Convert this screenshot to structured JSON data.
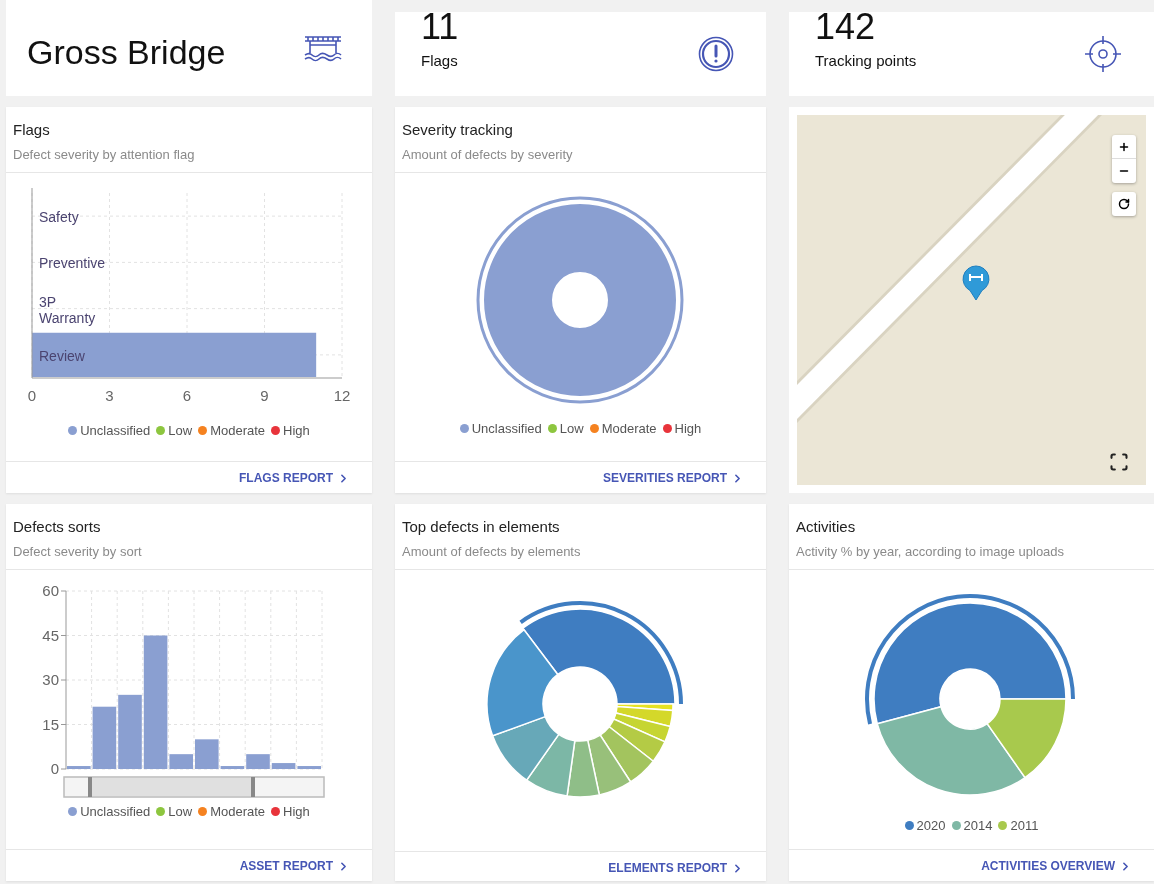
{
  "header_cards": [
    {
      "kind": "title",
      "title": "Gross Bridge"
    },
    {
      "kind": "stat",
      "value": "11",
      "label": "Flags"
    },
    {
      "kind": "stat",
      "value": "142",
      "label": "Tracking points"
    }
  ],
  "flags": {
    "title": "Flags",
    "subtitle": "Defect severity by attention flag",
    "chart_data": {
      "type": "bar",
      "orientation": "horizontal",
      "grid": true,
      "categories": [
        "Safety",
        "Preventive",
        "3P Warranty",
        "Review"
      ],
      "series": [
        {
          "name": "Unclassified",
          "color": "#8a9fd1",
          "values": [
            0,
            0,
            0,
            11
          ]
        },
        {
          "name": "Low",
          "color": "#8dc63f",
          "values": [
            0,
            0,
            0,
            0
          ]
        },
        {
          "name": "Moderate",
          "color": "#f58220",
          "values": [
            0,
            0,
            0,
            0
          ]
        },
        {
          "name": "High",
          "color": "#e8343b",
          "values": [
            0,
            0,
            0,
            0
          ]
        }
      ],
      "xlim": [
        0,
        12
      ],
      "xticks": [
        0,
        3,
        6,
        9,
        12
      ]
    },
    "link": "FLAGS REPORT"
  },
  "severity": {
    "title": "Severity tracking",
    "subtitle": "Amount of defects by severity",
    "legend": [
      {
        "label": "Unclassified",
        "color": "#8a9fd1"
      },
      {
        "label": "Low",
        "color": "#8dc63f"
      },
      {
        "label": "Moderate",
        "color": "#f58220"
      },
      {
        "label": "High",
        "color": "#e8343b"
      }
    ],
    "link": "SEVERITIES REPORT"
  },
  "defects_sorts": {
    "title": "Defects sorts",
    "subtitle": "Defect severity by sort",
    "chart_data": {
      "type": "bar",
      "orientation": "vertical",
      "grid": true,
      "series": [
        {
          "name": "Unclassified",
          "color": "#8a9fd1",
          "values": [
            1,
            21,
            25,
            45,
            5,
            10,
            1,
            5,
            2,
            1
          ]
        },
        {
          "name": "Low",
          "color": "#8dc63f",
          "values": [
            0,
            0,
            0,
            0,
            0,
            0,
            0,
            0,
            0,
            0
          ]
        },
        {
          "name": "Moderate",
          "color": "#f58220",
          "values": [
            0,
            0,
            0,
            0,
            0,
            0,
            0,
            0,
            0,
            0
          ]
        },
        {
          "name": "High",
          "color": "#e8343b",
          "values": [
            0,
            0,
            0,
            0,
            0,
            0,
            0,
            0,
            0,
            0
          ]
        }
      ],
      "ylim": [
        0,
        60
      ],
      "yticks": [
        0,
        15,
        30,
        45,
        60
      ]
    },
    "link": "ASSET REPORT"
  },
  "top_defects": {
    "title": "Top defects in elements",
    "subtitle": "Amount of defects by elements",
    "link": "ELEMENTS REPORT"
  },
  "activities": {
    "title": "Activities",
    "subtitle": "Activity % by year, according to image uploads",
    "legend": [
      {
        "label": "2020",
        "color": "#3f7dc1"
      },
      {
        "label": "2014",
        "color": "#7fb8a5"
      },
      {
        "label": "2011",
        "color": "#a8c94d"
      }
    ],
    "link": "ACTIVITIES OVERVIEW"
  }
}
